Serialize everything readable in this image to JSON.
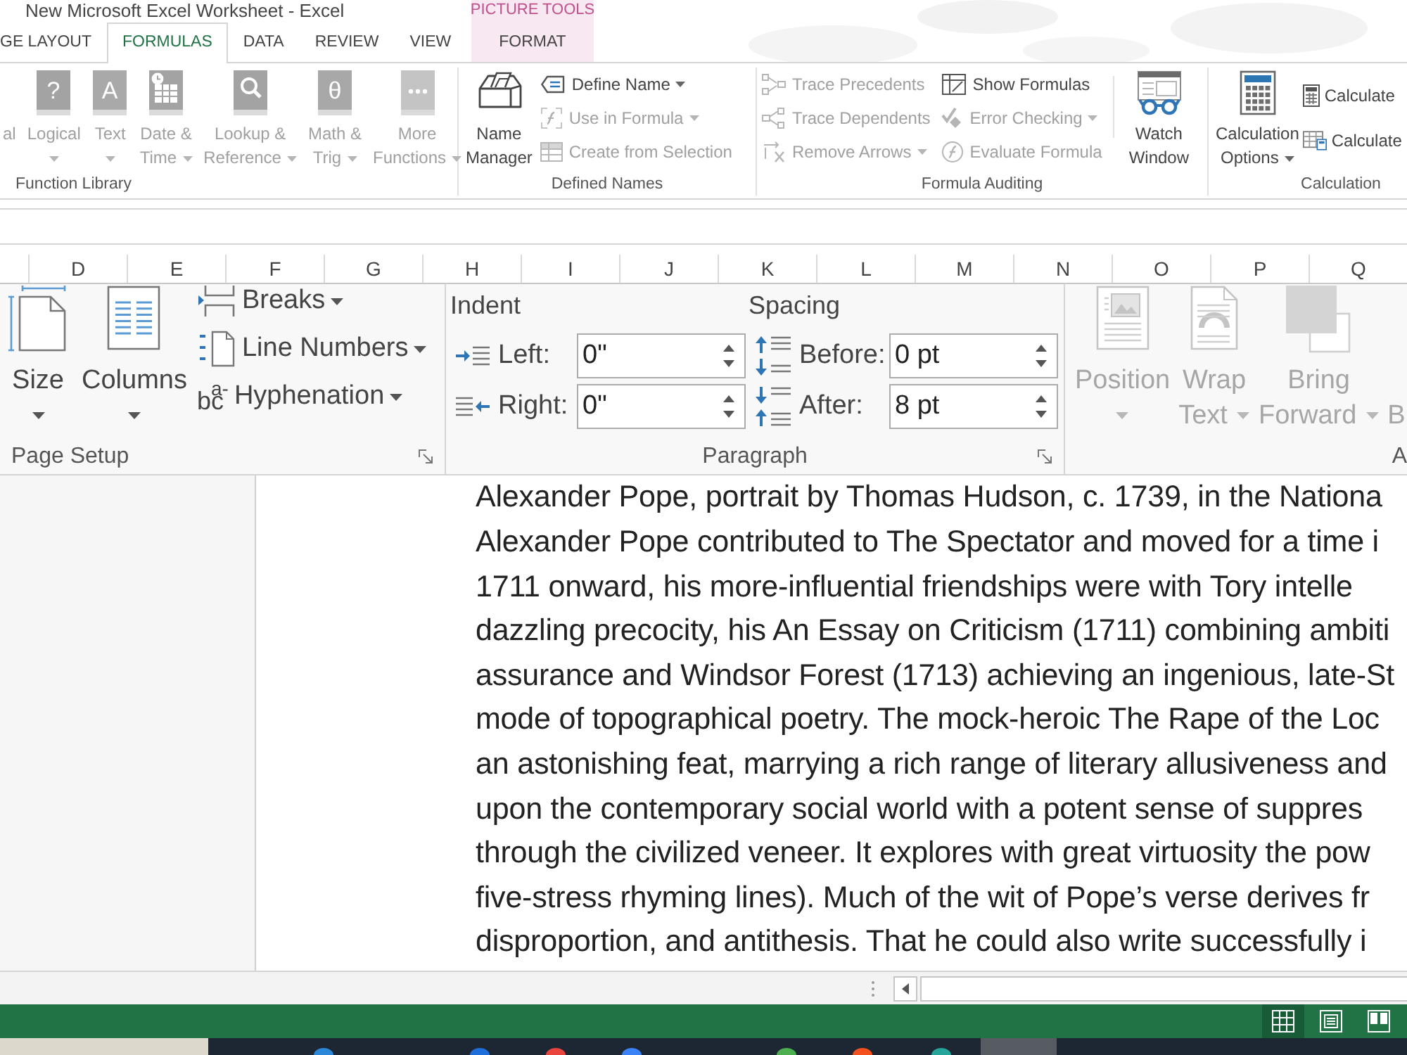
{
  "window": {
    "title": "New Microsoft Excel Worksheet - Excel"
  },
  "contextual_tab_group": {
    "label": "PICTURE TOOLS"
  },
  "ribbon_tabs": [
    {
      "label": "GE LAYOUT",
      "selected": false,
      "kind": "standard"
    },
    {
      "label": "FORMULAS",
      "selected": true,
      "kind": "standard"
    },
    {
      "label": "DATA",
      "selected": false,
      "kind": "standard"
    },
    {
      "label": "REVIEW",
      "selected": false,
      "kind": "standard"
    },
    {
      "label": "VIEW",
      "selected": false,
      "kind": "standard"
    },
    {
      "label": "FORMAT",
      "selected": false,
      "kind": "contextual"
    }
  ],
  "ribbon_groups": [
    {
      "label": "Function Library",
      "buttons": [
        {
          "kind": "large",
          "line1": "al",
          "dropdown": false,
          "disabled": true
        },
        {
          "kind": "large",
          "line1": "Logical",
          "dropdown": true,
          "disabled": true,
          "glyph": "?"
        },
        {
          "kind": "large",
          "line1": "Text",
          "dropdown": true,
          "disabled": true,
          "glyph": "A"
        },
        {
          "kind": "large",
          "line1": "Date &",
          "line2": "Time",
          "dropdown": true,
          "disabled": true
        },
        {
          "kind": "large",
          "line1": "Lookup &",
          "line2": "Reference",
          "dropdown": true,
          "disabled": true
        },
        {
          "kind": "large",
          "line1": "Math &",
          "line2": "Trig",
          "dropdown": true,
          "disabled": true,
          "glyph": "θ"
        },
        {
          "kind": "large",
          "line1": "More",
          "line2": "Functions",
          "dropdown": true,
          "disabled": true
        }
      ]
    },
    {
      "label": "Defined Names",
      "buttons": [
        {
          "kind": "large",
          "line1": "Name",
          "line2": "Manager",
          "dropdown": false,
          "disabled": false
        },
        {
          "kind": "small",
          "label": "Define Name",
          "dropdown": true,
          "disabled": false
        },
        {
          "kind": "small",
          "label": "Use in Formula",
          "dropdown": true,
          "disabled": true
        },
        {
          "kind": "small",
          "label": "Create from Selection",
          "dropdown": false,
          "disabled": true
        }
      ]
    },
    {
      "label": "Formula Auditing",
      "buttons": [
        {
          "kind": "small",
          "label": "Trace Precedents",
          "dropdown": false,
          "disabled": true
        },
        {
          "kind": "small",
          "label": "Trace Dependents",
          "dropdown": false,
          "disabled": true
        },
        {
          "kind": "small",
          "label": "Remove Arrows",
          "dropdown": true,
          "disabled": true
        },
        {
          "kind": "small",
          "label": "Show Formulas",
          "dropdown": false,
          "disabled": false
        },
        {
          "kind": "small",
          "label": "Error Checking",
          "dropdown": true,
          "disabled": true
        },
        {
          "kind": "small",
          "label": "Evaluate Formula",
          "dropdown": false,
          "disabled": true
        },
        {
          "kind": "large",
          "line1": "Watch",
          "line2": "Window",
          "dropdown": false,
          "disabled": false
        }
      ]
    },
    {
      "label": "Calculation",
      "buttons": [
        {
          "kind": "large",
          "line1": "Calculation",
          "line2": "Options",
          "dropdown": true,
          "disabled": false
        },
        {
          "kind": "small",
          "label": "Calculate",
          "dropdown": false,
          "disabled": false
        },
        {
          "kind": "small",
          "label": "Calculate",
          "dropdown": false,
          "disabled": false
        }
      ]
    }
  ],
  "worksheet": {
    "column_headers": [
      "D",
      "E",
      "F",
      "G",
      "H",
      "I",
      "J",
      "K",
      "L",
      "M",
      "N",
      "O",
      "P",
      "Q"
    ]
  },
  "embedded_document": {
    "ribbon_groups": [
      {
        "label": "Page Setup",
        "dialog_launcher": true,
        "buttons": [
          {
            "kind": "large",
            "line1": "Size",
            "dropdown": true,
            "disabled": false
          },
          {
            "kind": "large",
            "line1": "Columns",
            "dropdown": true,
            "disabled": false
          },
          {
            "kind": "small",
            "label": "Breaks",
            "dropdown": true,
            "disabled": false
          },
          {
            "kind": "small",
            "label": "Line Numbers",
            "dropdown": true,
            "disabled": false
          },
          {
            "kind": "small",
            "label": "Hyphenation",
            "dropdown": true,
            "disabled": false,
            "glyph": "bc$^{a-}$"
          }
        ]
      },
      {
        "label": "Paragraph",
        "dialog_launcher": true,
        "sections": [
          {
            "heading": "Indent",
            "fields": [
              {
                "label": "Left:",
                "value": "0\""
              },
              {
                "label": "Right:",
                "value": "0\""
              }
            ]
          },
          {
            "heading": "Spacing",
            "fields": [
              {
                "label": "Before:",
                "value": "0 pt"
              },
              {
                "label": "After:",
                "value": "8 pt"
              }
            ]
          }
        ]
      },
      {
        "label": "A",
        "buttons": [
          {
            "kind": "large",
            "line1": "Position",
            "dropdown": true,
            "disabled": true
          },
          {
            "kind": "large",
            "line1": "Wrap",
            "line2": "Text",
            "dropdown": true,
            "disabled": true
          },
          {
            "kind": "large",
            "line1": "Bring",
            "line2": "Forward",
            "dropdown": true,
            "disabled": true
          },
          {
            "kind": "large",
            "line2": "B",
            "dropdown": false,
            "disabled": true
          }
        ]
      }
    ],
    "caption": "Alexander Pope, portrait by Thomas Hudson, c. 1739, in the Nationa",
    "paragraph_lines": [
      "Alexander Pope contributed to The Spectator and moved for a time i",
      "1711 onward, his more-influential friendships were with Tory intelle",
      "dazzling precocity, his An Essay on Criticism (1711) combining ambiti",
      "assurance and Windsor Forest (1713) achieving an ingenious, late-St",
      "mode of topographical poetry. The mock-heroic The Rape of the Loc",
      "an astonishing feat, marrying a rich range of literary allusiveness and",
      "upon the contemporary social world with a potent sense of suppres",
      "through the civilized veneer. It explores with great virtuosity the pow",
      "five-stress rhyming lines). Much of the wit of Pope’s verse derives fr",
      "disproportion, and antithesis. That he could also write successfully i"
    ]
  },
  "status_bar": {
    "view_buttons": [
      {
        "selected": true
      },
      {
        "selected": false
      },
      {
        "selected": false
      }
    ]
  },
  "taskbar": {
    "apps": [
      {
        "color": "#2b88d8",
        "selected": false
      },
      {
        "color": "#1e6fd9",
        "selected": false
      },
      {
        "color": "#e8453c",
        "selected": false
      },
      {
        "color": "#3b82f6",
        "selected": false
      },
      {
        "color": "#4caf50",
        "selected": false
      },
      {
        "color": "#f4511e",
        "selected": false
      },
      {
        "color": "#26a69a",
        "selected": false
      },
      {
        "selected": true
      }
    ]
  }
}
